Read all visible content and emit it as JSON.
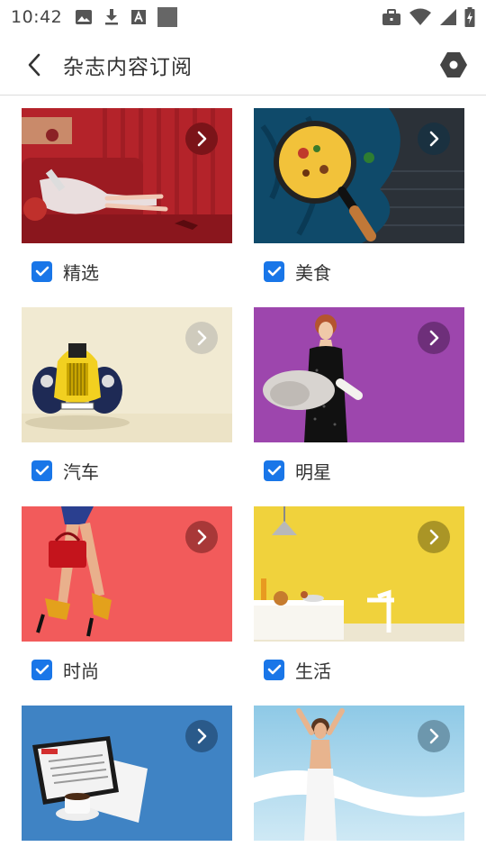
{
  "status_bar": {
    "time": "10:42",
    "left_icons": [
      "image-icon",
      "download-icon",
      "font-icon",
      "square-icon"
    ],
    "right_icons": [
      "briefcase-icon",
      "wifi-icon",
      "signal-icon",
      "battery-charging-icon"
    ]
  },
  "header": {
    "title": "杂志内容订阅",
    "back_icon": "chevron-left-icon",
    "settings_icon": "hexagon-settings-icon"
  },
  "categories": [
    {
      "label": "精选",
      "checked": true,
      "image": "woman-on-red-sofa",
      "accent": "#b4232a"
    },
    {
      "label": "美食",
      "checked": true,
      "image": "pan-of-food-on-blue-cloth",
      "accent": "#0f4a6a"
    },
    {
      "label": "汽车",
      "checked": true,
      "image": "yellow-vintage-car",
      "accent": "#f1ead2"
    },
    {
      "label": "明星",
      "checked": true,
      "image": "woman-in-black-dress",
      "accent": "#9d46ad"
    },
    {
      "label": "时尚",
      "checked": true,
      "image": "legs-with-red-bag",
      "accent": "#f25b5b"
    },
    {
      "label": "生活",
      "checked": true,
      "image": "yellow-dining-room",
      "accent": "#f0d23c"
    },
    {
      "label": "",
      "checked": null,
      "image": "tablet-news-and-coffee",
      "accent": "#3f83c4"
    },
    {
      "label": "",
      "checked": null,
      "image": "woman-with-white-fabric",
      "accent": "#9fd0e8"
    }
  ],
  "colors": {
    "checkbox": "#1976e8",
    "divider": "#dcdcdc"
  }
}
